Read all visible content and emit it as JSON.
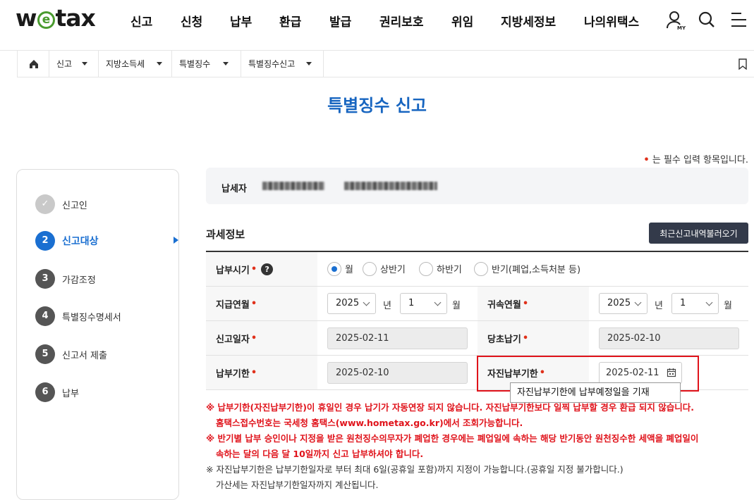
{
  "header": {
    "logo": {
      "pre": "w",
      "mid": "e",
      "post": "tax"
    },
    "menu": [
      "신고",
      "신청",
      "납부",
      "환급",
      "발급",
      "권리보호",
      "위임",
      "지방세정보",
      "나의위택스"
    ],
    "my_label": "MY"
  },
  "breadcrumb": [
    "신고",
    "지방소득세",
    "특별징수",
    "특별징수신고"
  ],
  "page_title": "특별징수 신고",
  "required_note": {
    "mark": "•",
    "text": "는 필수 입력 항목입니다."
  },
  "steps": [
    {
      "num": "✓",
      "label": "신고인",
      "state": "done"
    },
    {
      "num": "2",
      "label": "신고대상",
      "state": "active"
    },
    {
      "num": "3",
      "label": "가감조정",
      "state": "todo"
    },
    {
      "num": "4",
      "label": "특별징수명세서",
      "state": "todo"
    },
    {
      "num": "5",
      "label": "신고서 제출",
      "state": "todo"
    },
    {
      "num": "6",
      "label": "납부",
      "state": "todo"
    }
  ],
  "taxpayer": {
    "label": "납세자"
  },
  "section": {
    "title": "과세정보",
    "recent_button": "최근신고내역불러오기"
  },
  "form": {
    "period": {
      "label": "납부시기",
      "help": "?",
      "options": [
        "월",
        "상반기",
        "하반기",
        "반기(폐업,소득처분 등)"
      ],
      "selected": "월"
    },
    "pay_ym": {
      "label": "지급연월",
      "year": "2025",
      "year_unit": "년",
      "month": "1",
      "month_unit": "월"
    },
    "attr_ym": {
      "label": "귀속연월",
      "year": "2025",
      "year_unit": "년",
      "month": "1",
      "month_unit": "월"
    },
    "report_date": {
      "label": "신고일자",
      "value": "2025-02-11"
    },
    "orig_due": {
      "label": "당초납기",
      "value": "2025-02-10"
    },
    "due_date": {
      "label": "납부기한",
      "value": "2025-02-10"
    },
    "self_due": {
      "label": "자진납부기한",
      "value": "2025-02-11"
    },
    "star": "•",
    "tooltip": "자진납부기한에 납부예정일을 기재"
  },
  "notes": [
    {
      "cls": "red",
      "text": "※ 납부기한(자진납부기한)이 휴일인 경우 납기가 자동연장 되지 않습니다. 자진납부기한보다 일찍 납부할 경우 환급 되지 않습니다."
    },
    {
      "cls": "red ind",
      "text": "홈택스접수번호는 국세청 홈택스(www.hometax.go.kr)에서 조회가능합니다."
    },
    {
      "cls": "red",
      "text": "※ 반기별 납부 승인이나 지정을 받은 원천징수의무자가 폐업한 경우에는 폐업일에 속하는 해당 반기동안 원천징수한 세액을 폐업일이"
    },
    {
      "cls": "red ind",
      "text": "속하는 달의 다음 달 10일까지 신고 납부하셔야 합니다."
    },
    {
      "cls": "gray",
      "text": "※ 자진납부기한은 납부기한일자로 부터 최대 6일(공휴일 포함)까지 지정이 가능합니다.(공휴일 지정 불가합니다.)"
    },
    {
      "cls": "gray ind",
      "text": "가산세는 자진납부기한일자까지 계산됩니다."
    }
  ]
}
